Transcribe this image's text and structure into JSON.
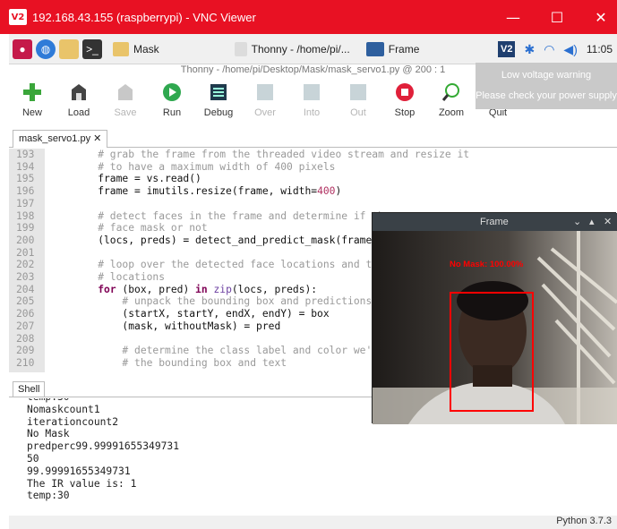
{
  "vnc": {
    "logo": "V2",
    "title": "192.168.43.155 (raspberrypi) - VNC Viewer",
    "controls": {
      "minimize": "—",
      "maximize": "☐",
      "close": "✕"
    }
  },
  "taskbar": {
    "launchers": [
      "raspberry-icon",
      "globe-icon",
      "folder-icon",
      "terminal-icon"
    ],
    "tasks": [
      {
        "label": "Mask",
        "icon": "folder-icon"
      },
      {
        "label": "Thonny - /home/pi/...",
        "icon": "thonny-icon"
      },
      {
        "label": "Frame",
        "icon": "window-icon"
      }
    ],
    "tray": {
      "vnc": "V2",
      "bluetooth": "bluetooth-icon",
      "wifi": "wifi-icon",
      "volume": "volume-icon",
      "time": "11:05"
    }
  },
  "voltage_popup": {
    "title": "Low voltage warning",
    "message": "Please check your power supply"
  },
  "thonny": {
    "title": "Thonny - /home/pi/Desktop/Mask/mask_servo1.py @ 200 : 1",
    "toolbar": [
      {
        "label": "New",
        "icon": "new-icon",
        "enabled": true
      },
      {
        "label": "Load",
        "icon": "load-icon",
        "enabled": true
      },
      {
        "label": "Save",
        "icon": "save-icon",
        "enabled": false
      },
      {
        "label": "Run",
        "icon": "run-icon",
        "enabled": true
      },
      {
        "label": "Debug",
        "icon": "debug-icon",
        "enabled": true
      },
      {
        "label": "Over",
        "icon": "step-over-icon",
        "enabled": false
      },
      {
        "label": "Into",
        "icon": "step-into-icon",
        "enabled": false
      },
      {
        "label": "Out",
        "icon": "step-out-icon",
        "enabled": false
      },
      {
        "label": "Stop",
        "icon": "stop-icon",
        "enabled": true
      },
      {
        "label": "Zoom",
        "icon": "zoom-icon",
        "enabled": true
      },
      {
        "label": "Quit",
        "icon": "quit-icon",
        "enabled": true
      }
    ],
    "editor_tab": "mask_servo1.py ✕",
    "code_lines": [
      {
        "n": "193",
        "text": "    # grab the frame from the threaded video stream and resize it"
      },
      {
        "n": "194",
        "text": "    # to have a maximum width of 400 pixels"
      },
      {
        "n": "195",
        "text": "    frame = vs.read()"
      },
      {
        "n": "196",
        "text": "    frame = imutils.resize(frame, width=400)"
      },
      {
        "n": "197",
        "text": ""
      },
      {
        "n": "198",
        "text": "    # detect faces in the frame and determine if they"
      },
      {
        "n": "199",
        "text": "    # face mask or not"
      },
      {
        "n": "200",
        "text": "    (locs, preds) = detect_and_predict_mask(frame, fac"
      },
      {
        "n": "201",
        "text": ""
      },
      {
        "n": "202",
        "text": "    # loop over the detected face locations and their"
      },
      {
        "n": "203",
        "text": "    # locations"
      },
      {
        "n": "204",
        "text": "    for (box, pred) in zip(locs, preds):"
      },
      {
        "n": "205",
        "text": "        # unpack the bounding box and predictions"
      },
      {
        "n": "206",
        "text": "        (startX, startY, endX, endY) = box"
      },
      {
        "n": "207",
        "text": "        (mask, withoutMask) = pred"
      },
      {
        "n": "208",
        "text": ""
      },
      {
        "n": "209",
        "text": "        # determine the class label and color we'll us"
      },
      {
        "n": "210",
        "text": "        # the bounding box and text"
      }
    ],
    "shell_tab": "Shell",
    "shell_lines": [
      "temp:30",
      "Nomaskcount1",
      "iterationcount2",
      "No Mask",
      "predperc99.99991655349731",
      "50",
      "99.99991655349731",
      "The IR value is: 1",
      "temp:30"
    ],
    "status": "Python 3.7.3"
  },
  "frame_window": {
    "title": "Frame",
    "detection_label": "No Mask: 100.00%",
    "box_color": "#ff0000"
  },
  "colors": {
    "vnc_title": "#e81123",
    "thonny_kw": "#7f0055",
    "comment": "#999999"
  }
}
